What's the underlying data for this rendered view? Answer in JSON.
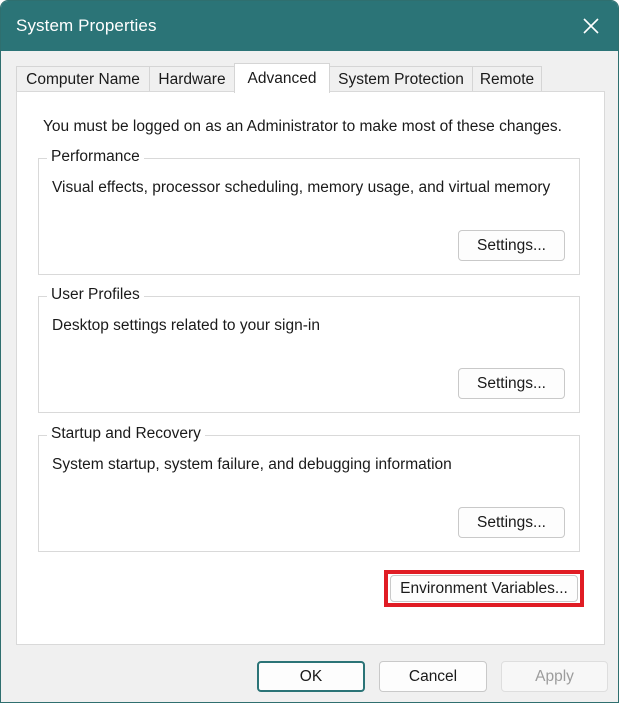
{
  "window": {
    "title": "System Properties",
    "accent_color": "#2b7477",
    "close_icon": "close-icon"
  },
  "tabs": [
    {
      "label": "Computer Name",
      "active": false
    },
    {
      "label": "Hardware",
      "active": false
    },
    {
      "label": "Advanced",
      "active": true
    },
    {
      "label": "System Protection",
      "active": false
    },
    {
      "label": "Remote",
      "active": false
    }
  ],
  "advanced": {
    "notice": "You must be logged on as an Administrator to make most of these changes.",
    "groups": [
      {
        "title": "Performance",
        "description": "Visual effects, processor scheduling, memory usage, and virtual memory",
        "button": "Settings..."
      },
      {
        "title": "User Profiles",
        "description": "Desktop settings related to your sign-in",
        "button": "Settings..."
      },
      {
        "title": "Startup and Recovery",
        "description": "System startup, system failure, and debugging information",
        "button": "Settings..."
      }
    ],
    "env_button": "Environment Variables...",
    "highlight_color": "#e01c24"
  },
  "footer": {
    "ok": "OK",
    "cancel": "Cancel",
    "apply": "Apply"
  }
}
